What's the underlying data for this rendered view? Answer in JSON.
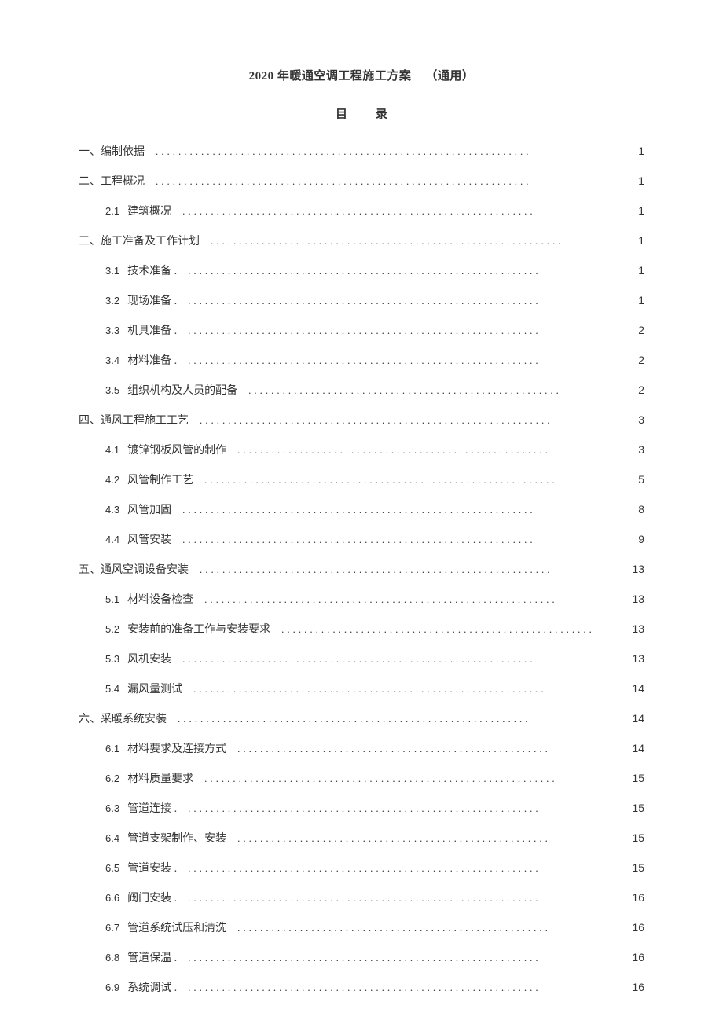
{
  "title_main": "2020 年暖通空调工程施工方案",
  "title_suffix": "（通用）",
  "toc_heading_a": "目",
  "toc_heading_b": "录",
  "dots_short": "..............................................................",
  "dots_med": ".......................................................",
  "dots_long": "..................................................................",
  "entries": [
    {
      "level": 1,
      "num": "",
      "label": "一、编制依据",
      "page": "1",
      "dotkey": "dots_long"
    },
    {
      "level": 1,
      "num": "",
      "label": "二、工程概况",
      "page": "1",
      "dotkey": "dots_long"
    },
    {
      "level": 2,
      "num": "2.1",
      "label": "建筑概况",
      "page": "1",
      "dotkey": "dots_short"
    },
    {
      "level": 1,
      "num": "",
      "label": "三、施工准备及工作计划",
      "page": "1",
      "dotkey": "dots_short"
    },
    {
      "level": 2,
      "num": "3.1",
      "label": "技术准备 .",
      "page": "1",
      "dotkey": "dots_short"
    },
    {
      "level": 2,
      "num": "3.2",
      "label": "现场准备 .",
      "page": "1",
      "dotkey": "dots_short"
    },
    {
      "level": 2,
      "num": "3.3",
      "label": "机具准备 .",
      "page": "2",
      "dotkey": "dots_short"
    },
    {
      "level": 2,
      "num": "3.4",
      "label": "材料准备 .",
      "page": "2",
      "dotkey": "dots_short"
    },
    {
      "level": 2,
      "num": "3.5",
      "label": "组织机构及人员的配备",
      "page": "2",
      "dotkey": "dots_med"
    },
    {
      "level": 1,
      "num": "",
      "label": "四、通风工程施工工艺",
      "page": "3",
      "dotkey": "dots_short"
    },
    {
      "level": 2,
      "num": "4.1",
      "label": "镀锌钢板风管的制作",
      "page": "3",
      "dotkey": "dots_med"
    },
    {
      "level": 2,
      "num": "4.2",
      "label": "风管制作工艺",
      "page": "5",
      "dotkey": "dots_short"
    },
    {
      "level": 2,
      "num": "4.3",
      "label": "风管加固",
      "page": "8",
      "dotkey": "dots_short"
    },
    {
      "level": 2,
      "num": "4.4",
      "label": "风管安装",
      "page": "9",
      "dotkey": "dots_short"
    },
    {
      "level": 1,
      "num": "",
      "label": "五、通风空调设备安装",
      "page": "13",
      "dotkey": "dots_short"
    },
    {
      "level": 2,
      "num": "5.1",
      "label": "材料设备检查",
      "page": "13",
      "dotkey": "dots_short"
    },
    {
      "level": 2,
      "num": "5.2",
      "label": "安装前的准备工作与安装要求",
      "page": "13",
      "dotkey": "dots_med"
    },
    {
      "level": 2,
      "num": "5.3",
      "label": "风机安装",
      "page": "13",
      "dotkey": "dots_short"
    },
    {
      "level": 2,
      "num": "5.4",
      "label": "漏风量测试",
      "page": "14",
      "dotkey": "dots_short"
    },
    {
      "level": 1,
      "num": "",
      "label": "六、采暖系统安装",
      "page": "14",
      "dotkey": "dots_short"
    },
    {
      "level": 2,
      "num": "6.1",
      "label": "材料要求及连接方式",
      "page": "14",
      "dotkey": "dots_med"
    },
    {
      "level": 2,
      "num": "6.2",
      "label": "材料质量要求",
      "page": "15",
      "dotkey": "dots_short"
    },
    {
      "level": 2,
      "num": "6.3",
      "label": "管道连接 .",
      "page": "15",
      "dotkey": "dots_short"
    },
    {
      "level": 2,
      "num": "6.4",
      "label": "管道支架制作、安装",
      "page": "15",
      "dotkey": "dots_med"
    },
    {
      "level": 2,
      "num": "6.5",
      "label": "管道安装 .",
      "page": "15",
      "dotkey": "dots_short"
    },
    {
      "level": 2,
      "num": "6.6",
      "label": "阀门安装 .",
      "page": "16",
      "dotkey": "dots_short"
    },
    {
      "level": 2,
      "num": "6.7",
      "label": "管道系统试压和清洗",
      "page": "16",
      "dotkey": "dots_med"
    },
    {
      "level": 2,
      "num": "6.8",
      "label": "管道保温 .",
      "page": "16",
      "dotkey": "dots_short"
    },
    {
      "level": 2,
      "num": "6.9",
      "label": "系统调试 .",
      "page": "16",
      "dotkey": "dots_short"
    }
  ]
}
